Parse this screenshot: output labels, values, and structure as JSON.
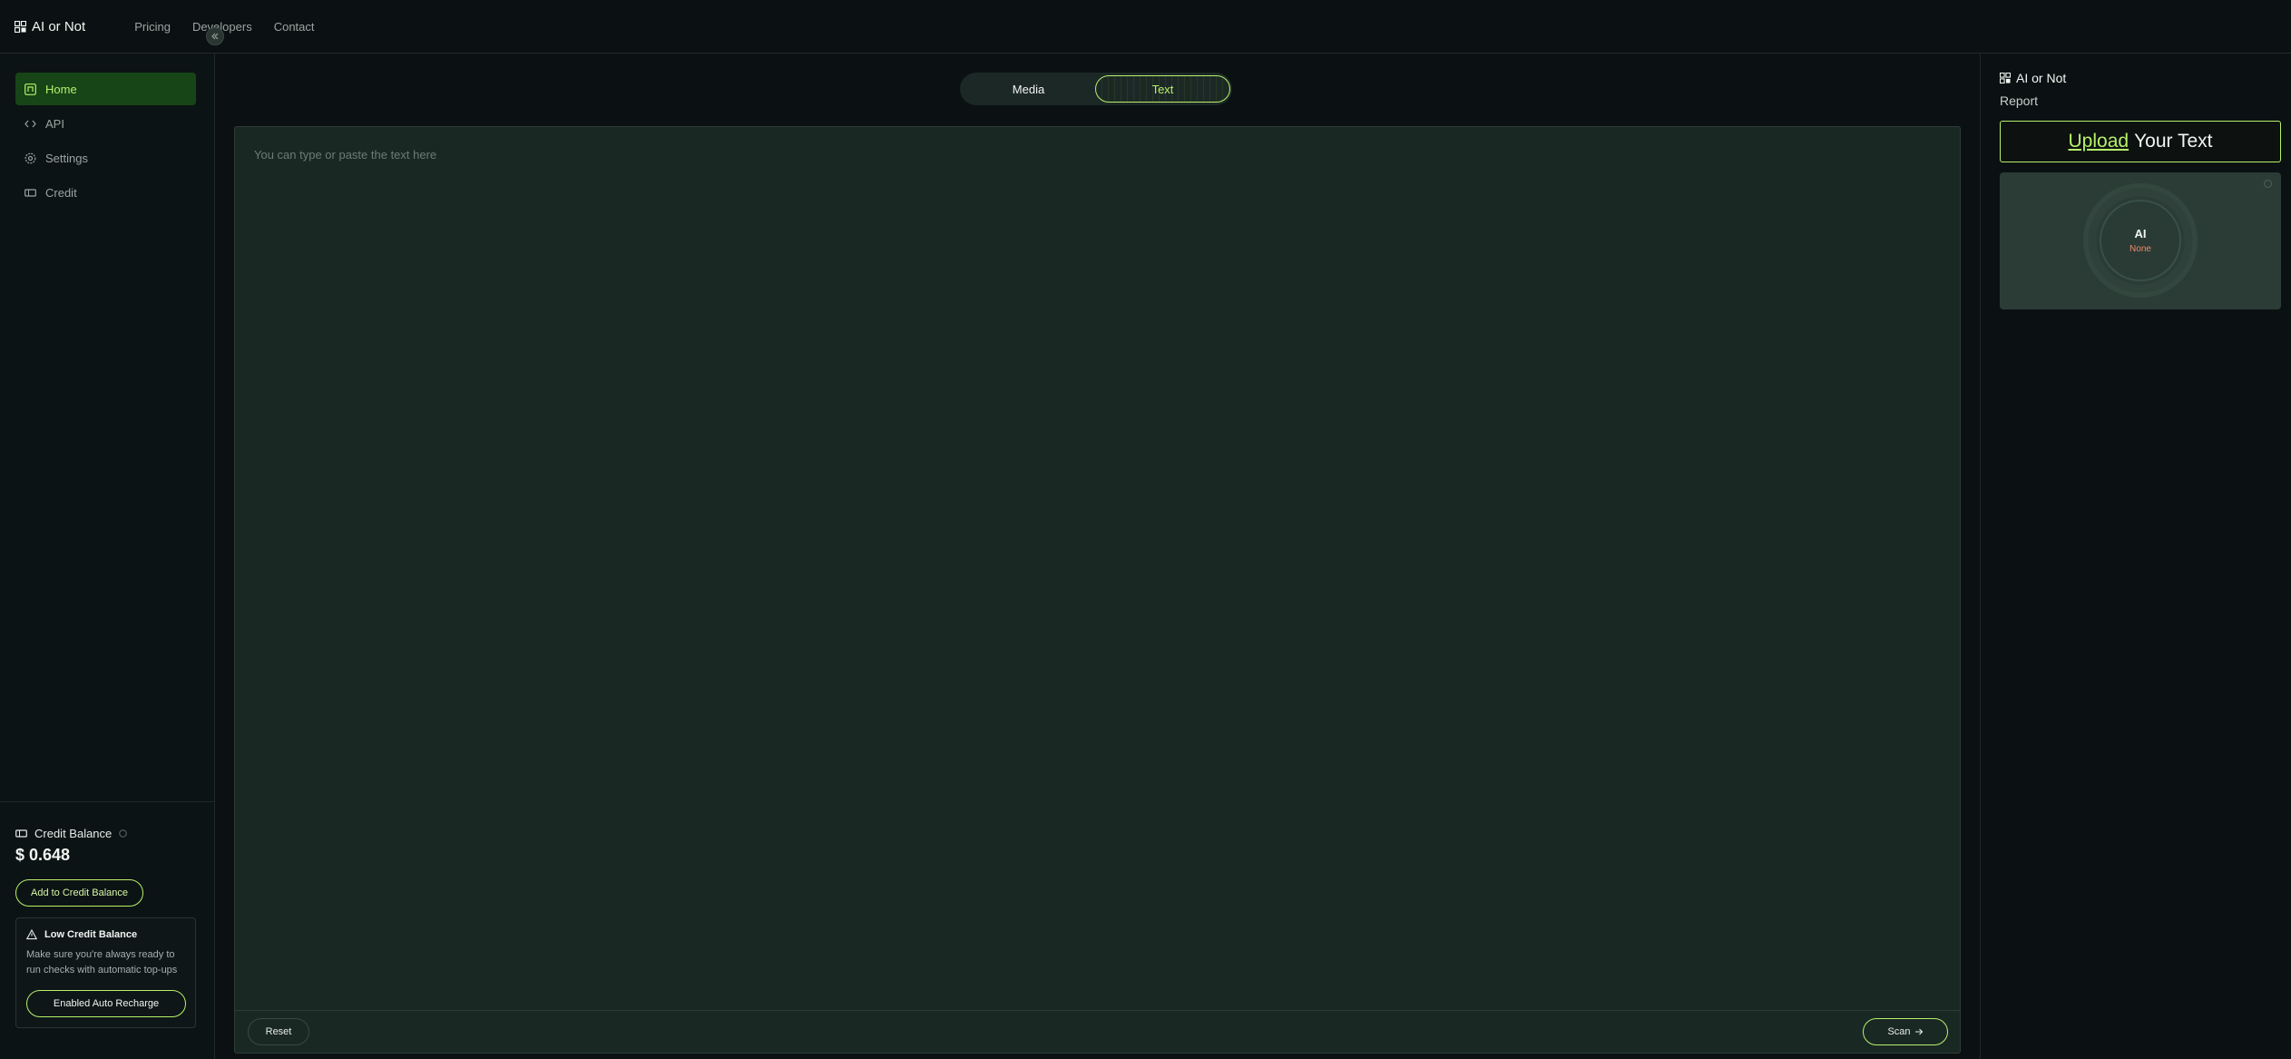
{
  "app": {
    "brand": "AI or Not",
    "nav": [
      "Pricing",
      "Developers",
      "Contact"
    ]
  },
  "sidebar": {
    "items": [
      {
        "label": "Home",
        "icon": "home-icon",
        "active": true
      },
      {
        "label": "API",
        "icon": "code-icon",
        "active": false
      },
      {
        "label": "Settings",
        "icon": "gear-icon",
        "active": false
      },
      {
        "label": "Credit",
        "icon": "ticket-icon",
        "active": false
      }
    ],
    "credit": {
      "label": "Credit Balance",
      "amount": "$ 0.648",
      "add_button": "Add to Credit Balance"
    },
    "low_balance": {
      "title": "Low Credit Balance",
      "description": "Make sure you're always ready to run checks with automatic top-ups",
      "button": "Enabled Auto Recharge"
    }
  },
  "main": {
    "tabs": [
      {
        "label": "Media",
        "active": false
      },
      {
        "label": "Text",
        "active": true
      }
    ],
    "editor": {
      "placeholder": "You can type or paste the text here",
      "value": ""
    },
    "reset_label": "Reset",
    "scan_label": "Scan"
  },
  "report": {
    "brand": "AI or Not",
    "subtitle": "Report",
    "upload_link": "Upload",
    "upload_rest": "Your Text",
    "gauge_label": "AI",
    "gauge_value": "None"
  },
  "colors": {
    "accent": "#b7f06a",
    "active_bg": "#174517",
    "background": "#0b1112",
    "panel": "#1a2824",
    "gauge_value": "#f08a6a"
  }
}
